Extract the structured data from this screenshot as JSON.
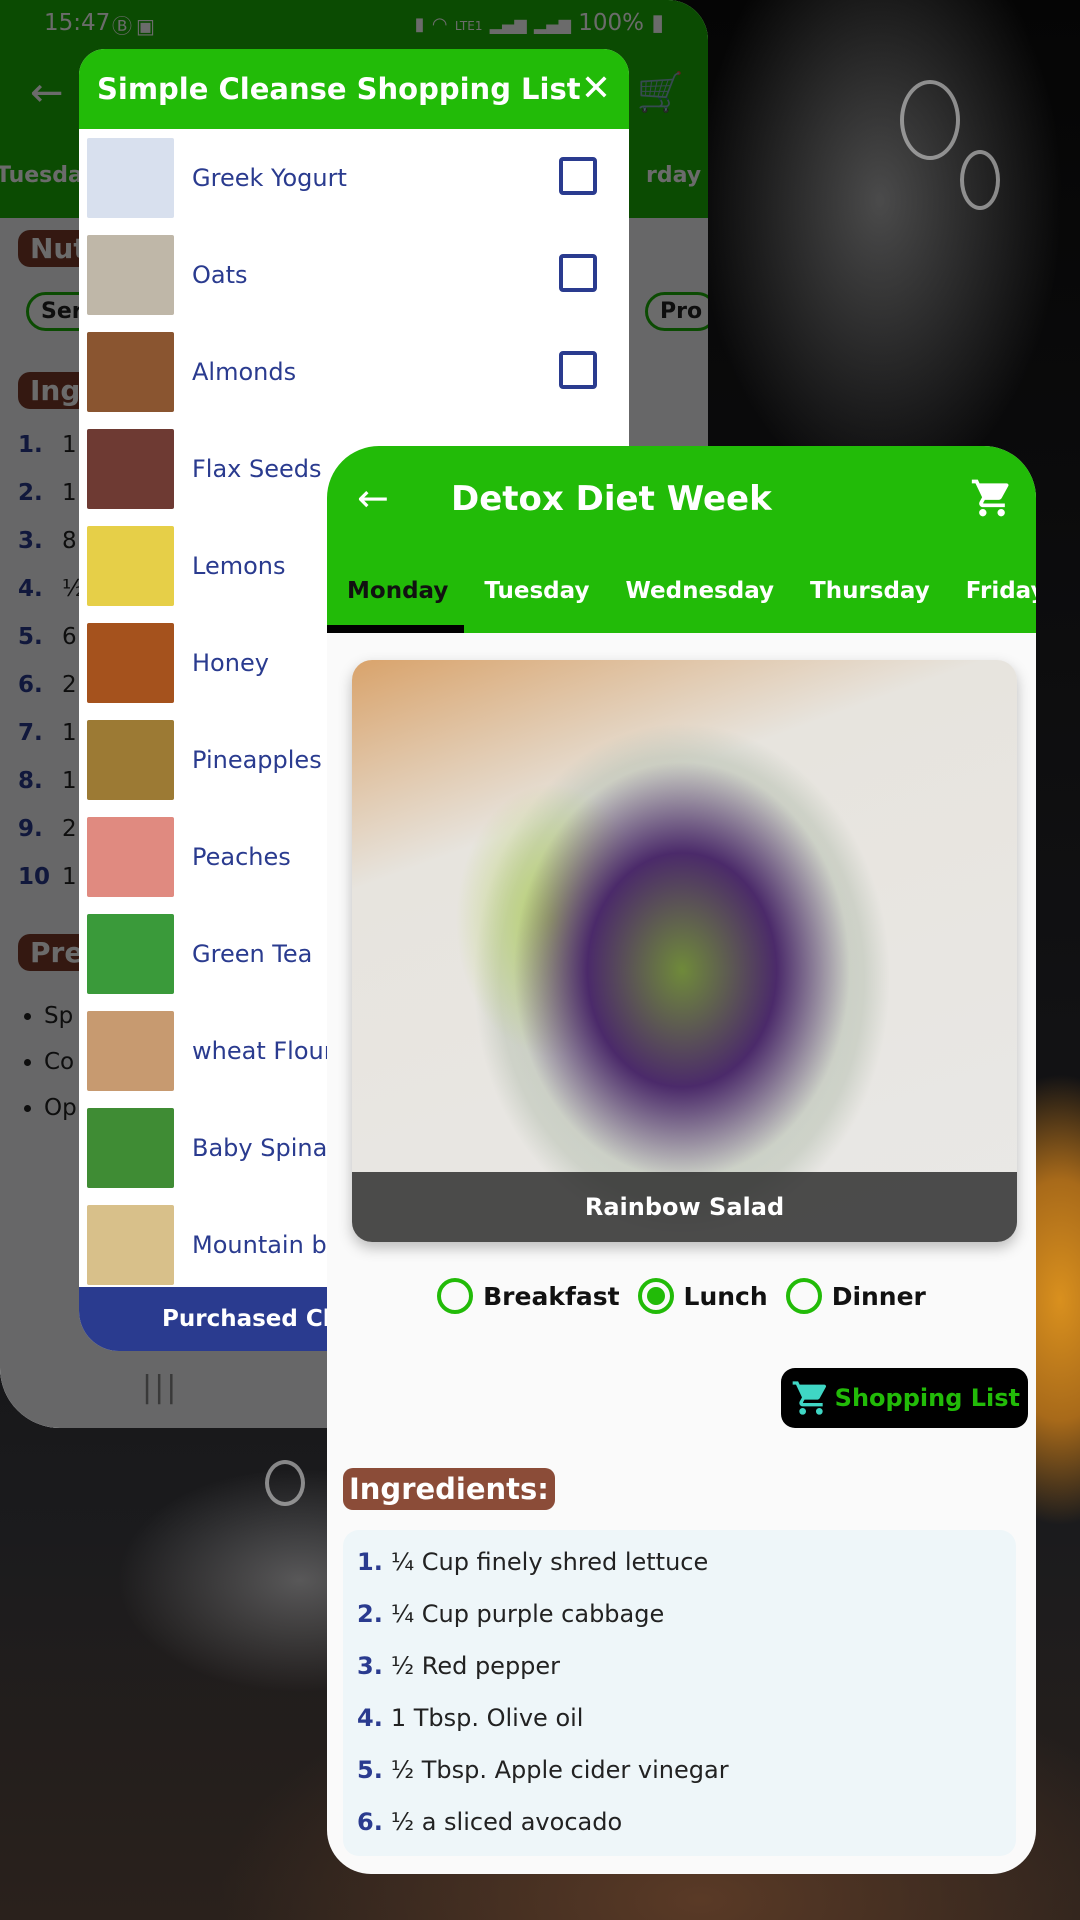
{
  "status_bar": {
    "time": "15:47",
    "left_icons": [
      "b-notification-icon",
      "image-icon"
    ],
    "right_icons": [
      "battery-saver-icon",
      "wifi-icon",
      "volte-lte1-icon",
      "signal-icon",
      "signal-icon"
    ],
    "battery": "100%"
  },
  "background_app": {
    "back_icon": "arrow-left-icon",
    "cart_icon": "cart-icon",
    "tabs_visible": [
      "Tuesday",
      "rday"
    ],
    "nutrition_chip": "Nutr",
    "serving_chip": "Serv",
    "protein_chip": "Pro",
    "ingredients_chip": "Ingr",
    "ingredient_numbers": [
      {
        "num": "1.",
        "text": "1"
      },
      {
        "num": "2.",
        "text": "1"
      },
      {
        "num": "3.",
        "text": "8"
      },
      {
        "num": "4.",
        "text": "½"
      },
      {
        "num": "5.",
        "text": "6"
      },
      {
        "num": "6.",
        "text": "2"
      },
      {
        "num": "7.",
        "text": "1"
      },
      {
        "num": "8.",
        "text": "1"
      },
      {
        "num": "9.",
        "text": "2"
      },
      {
        "num": "10",
        "text": "1"
      }
    ],
    "preparation_chip": "Prep",
    "preparation_bullets": [
      "Sp co yo Pl",
      "Co th wi",
      "Op ta sk"
    ],
    "nav_recent_icon": "recent-apps-icon"
  },
  "shopping_dialog": {
    "title": "Simple Cleanse Shopping List",
    "close_icon": "close-icon",
    "items": [
      {
        "name": "Greek Yogurt",
        "checked": false,
        "thumb_color": "#d8e0ee"
      },
      {
        "name": "Oats",
        "checked": false,
        "thumb_color": "#bfb7a8"
      },
      {
        "name": "Almonds",
        "checked": false,
        "thumb_color": "#8a5530"
      },
      {
        "name": "Flax Seeds",
        "checked": false,
        "thumb_color": "#6e3a33"
      },
      {
        "name": "Lemons",
        "checked": false,
        "thumb_color": "#e6cf48"
      },
      {
        "name": "Honey",
        "checked": false,
        "thumb_color": "#a5521d"
      },
      {
        "name": "Pineapples",
        "checked": false,
        "thumb_color": "#9c7a34"
      },
      {
        "name": "Peaches",
        "checked": false,
        "thumb_color": "#e08a80"
      },
      {
        "name": "Green Tea",
        "checked": false,
        "thumb_color": "#3a9a3a"
      },
      {
        "name": "wheat Flour",
        "checked": false,
        "thumb_color": "#c79a70"
      },
      {
        "name": "Baby Spinach",
        "checked": false,
        "thumb_color": "#3f8c34"
      },
      {
        "name": "Mountain bread",
        "checked": false,
        "thumb_color": "#d8c08a"
      }
    ],
    "purchased_button": "Purchased Clear"
  },
  "foreground_app": {
    "title": "Detox Diet Week",
    "back_icon": "arrow-left-icon",
    "cart_icon": "cart-icon",
    "tabs": [
      {
        "label": "Monday",
        "active": true
      },
      {
        "label": "Tuesday",
        "active": false
      },
      {
        "label": "Wednesday",
        "active": false
      },
      {
        "label": "Thursday",
        "active": false
      },
      {
        "label": "Friday",
        "active": false
      }
    ],
    "meal_name": "Rainbow Salad",
    "meal_options": [
      {
        "label": "Breakfast",
        "selected": false
      },
      {
        "label": "Lunch",
        "selected": true
      },
      {
        "label": "Dinner",
        "selected": false
      }
    ],
    "shopping_list_button": "Shopping List",
    "ingredients_heading": "Ingredients:",
    "ingredients": [
      {
        "num": "1.",
        "text": "¼ Cup finely shred lettuce"
      },
      {
        "num": "2.",
        "text": "¼ Cup purple cabbage"
      },
      {
        "num": "3.",
        "text": "½ Red pepper"
      },
      {
        "num": "4.",
        "text": "1 Tbsp. Olive oil"
      },
      {
        "num": "5.",
        "text": "½ Tbsp. Apple cider vinegar"
      },
      {
        "num": "6.",
        "text": "½ a sliced avocado"
      }
    ]
  },
  "colors": {
    "primary_green": "#22bb08",
    "navy": "#2a3b8f",
    "brown_chip": "#8b4c38",
    "shopping_button_bg": "#000000",
    "cart_teal": "#3fd6c4"
  }
}
